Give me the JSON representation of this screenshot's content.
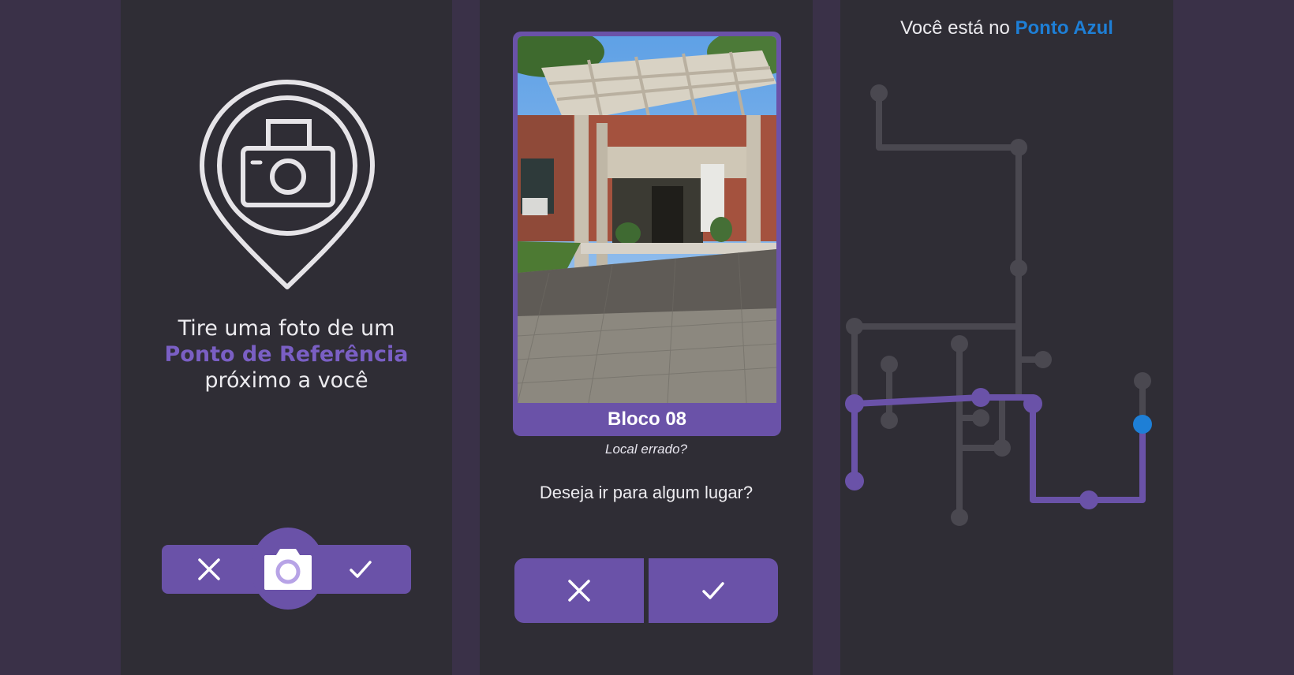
{
  "screen1": {
    "icon": "camera-location-pin-icon",
    "instruction_line1": "Tire uma foto de um",
    "instruction_highlight": "Ponto de Referência",
    "instruction_line3": "próximo a você",
    "buttons": {
      "cancel_icon": "close-icon",
      "camera_icon": "camera-icon",
      "confirm_icon": "check-icon"
    }
  },
  "screen2": {
    "photo_caption": "Bloco 08",
    "wrong_location_link": "Local errado?",
    "question": "Deseja ir para algum lugar?",
    "buttons": {
      "no_icon": "close-icon",
      "yes_icon": "check-icon"
    }
  },
  "screen3": {
    "location_prefix": "Você está no",
    "location_name": "Ponto Azul"
  },
  "colors": {
    "accent": "#6a52a8",
    "highlight_text": "#7a5fc4",
    "location_blue": "#1e7fd6",
    "panel_bg": "#2f2d35",
    "page_bg": "#3a3148",
    "path_gray": "#4a4850"
  }
}
